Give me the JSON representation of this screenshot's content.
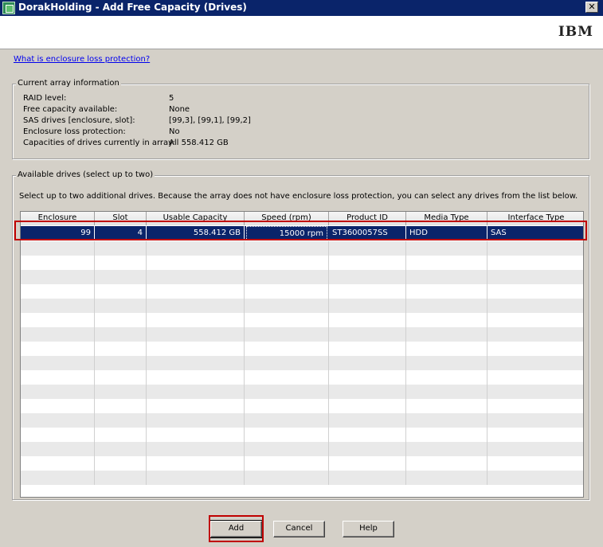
{
  "window": {
    "title": "DorakHolding - Add Free Capacity (Drives)",
    "close_glyph": "✕",
    "brand": "IBM"
  },
  "help_link": "What is enclosure loss protection?",
  "current_array": {
    "legend": "Current array information",
    "rows": [
      {
        "label": "RAID level:",
        "value": "5"
      },
      {
        "label": "Free capacity available:",
        "value": "None"
      },
      {
        "label": "SAS drives [enclosure, slot]:",
        "value": "[99,3], [99,1], [99,2]"
      },
      {
        "label": "Enclosure loss protection:",
        "value": "No"
      },
      {
        "label": "Capacities of drives currently in array:",
        "value": "All 558.412 GB"
      }
    ]
  },
  "available_drives": {
    "legend": "Available drives (select up to two)",
    "instructions": "Select up to two additional drives. Because the array does not have enclosure loss protection, you can select any drives from the list below.",
    "columns": [
      "Enclosure",
      "Slot",
      "Usable Capacity",
      "Speed (rpm)",
      "Product ID",
      "Media Type",
      "Interface Type"
    ],
    "rows": [
      {
        "enclosure": "99",
        "slot": "4",
        "capacity": "558.412 GB",
        "speed": "15000 rpm",
        "product_id": "ST3600057SS",
        "media": "HDD",
        "interface": "SAS",
        "selected": true
      }
    ]
  },
  "buttons": {
    "add": "Add",
    "cancel": "Cancel",
    "help": "Help"
  },
  "colors": {
    "title_bar": "#0a246a",
    "selection": "#0a246a",
    "highlight_box": "#c00000",
    "dialog_bg": "#d4d0c8"
  }
}
